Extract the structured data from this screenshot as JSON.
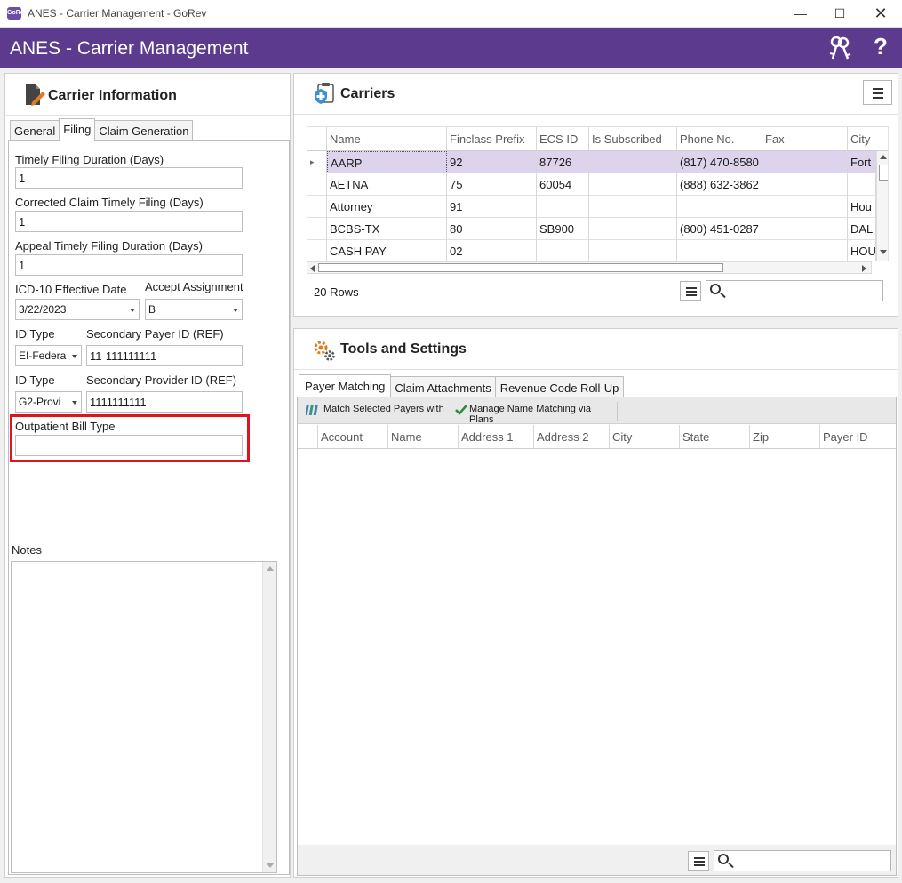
{
  "window": {
    "title": "ANES - Carrier Management - GoRev",
    "app_icon_text": "GoRev"
  },
  "header": {
    "title": "ANES - Carrier Management",
    "icons": [
      "keys-icon",
      "help-icon"
    ],
    "help_label": "?",
    "color": "#5c3b8e"
  },
  "carrier_info": {
    "title": "Carrier Information",
    "tabs": [
      {
        "label": "General",
        "active": false
      },
      {
        "label": "Filing",
        "active": true
      },
      {
        "label": "Claim Generation",
        "active": false
      }
    ],
    "fields": {
      "timely_filing_label": "Timely Filing Duration (Days)",
      "timely_filing_value": "1",
      "corrected_label": "Corrected Claim Timely Filing (Days)",
      "corrected_value": "1",
      "appeal_label": "Appeal Timely Filing Duration (Days)",
      "appeal_value": "1",
      "icd10_label": "ICD-10 Effective Date",
      "icd10_value": "3/22/2023",
      "accept_assignment_label": "Accept Assignment",
      "accept_assignment_value": "B",
      "id_type_label": "ID Type",
      "id_type_value": "EI-Federa",
      "secondary_payer_label": "Secondary Payer ID (REF)",
      "secondary_payer_value": "11-111111111",
      "id_type2_label": "ID Type",
      "id_type2_value": "G2-Provi",
      "secondary_provider_label": "Secondary Provider ID (REF)",
      "secondary_provider_value": "1111111111",
      "outpatient_label": "Outpatient Bill Type",
      "outpatient_value": ""
    },
    "notes_label": "Notes",
    "highlight_color": "#e0141e"
  },
  "carriers": {
    "title": "Carriers",
    "columns": [
      "Name",
      "Finclass Prefix",
      "ECS ID",
      "Is Subscribed",
      "Phone No.",
      "Fax",
      "City"
    ],
    "rows": [
      [
        "AARP",
        "92",
        "87726",
        "",
        "(817) 470-8580",
        "",
        "Fort"
      ],
      [
        "AETNA",
        "75",
        "60054",
        "",
        "(888) 632-3862",
        "",
        ""
      ],
      [
        "Attorney",
        "91",
        "",
        "",
        "",
        "",
        "Hou"
      ],
      [
        "BCBS-TX",
        "80",
        "SB900",
        "",
        "(800) 451-0287",
        "",
        "DAL"
      ],
      [
        "CASH PAY",
        "02",
        "",
        "",
        "",
        "",
        "HOU"
      ]
    ],
    "row_count": "20 Rows",
    "selected_row_color": "#ddd3ec"
  },
  "tools": {
    "title": "Tools and Settings",
    "tabs": [
      {
        "label": "Payer Matching",
        "active": true
      },
      {
        "label": "Claim Attachments",
        "active": false
      },
      {
        "label": "Revenue Code Roll-Up",
        "active": false
      }
    ],
    "toolbar": {
      "match_label": "Match Selected Payers with",
      "manage_label": "Manage Name Matching via Plans"
    },
    "columns": [
      "Account",
      "Name",
      "Address 1",
      "Address 2",
      "City",
      "State",
      "Zip",
      "Payer ID"
    ]
  }
}
